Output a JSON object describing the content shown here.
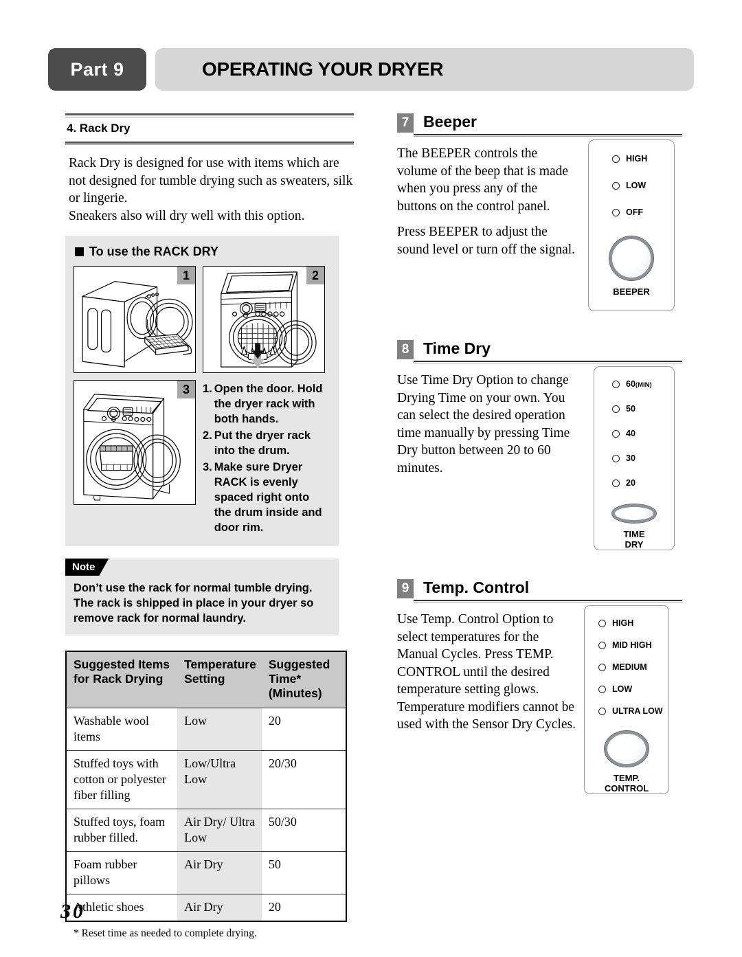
{
  "header": {
    "part_label": "Part 9",
    "title": "OPERATING YOUR DRYER"
  },
  "left_column": {
    "section_heading": "4. Rack Dry",
    "intro_paragraph_1": "Rack Dry is designed for use with items which are not designed for tumble drying such as sweaters, silk or lingerie.",
    "intro_paragraph_2": "Sneakers also will dry well with this option.",
    "rack_panel": {
      "title": "To use the RACK DRY",
      "figures": [
        {
          "number": "1",
          "caption": "dryer-with-rack-pulled-out-illustration"
        },
        {
          "number": "2",
          "caption": "inserting-rack-into-drum-illustration"
        },
        {
          "number": "3",
          "caption": "rack-installed-in-drum-illustration"
        }
      ],
      "steps": [
        {
          "num": "1.",
          "text": "Open the door. Hold the dryer rack with both hands."
        },
        {
          "num": "2.",
          "text": "Put the dryer rack into the drum."
        },
        {
          "num": "3.",
          "text": "Make sure Dryer RACK is evenly spaced right onto the drum inside and door rim."
        }
      ]
    },
    "note": {
      "tag": "Note",
      "line1": "Don’t use the rack for normal tumble drying.",
      "line2": "The rack is shipped in place in your dryer so remove rack for normal laundry."
    },
    "table": {
      "headers": [
        "Suggested Items for Rack Drying",
        "Temperature Setting",
        "Suggested Time* (Minutes)"
      ],
      "header_lines": [
        [
          "Suggested Items",
          "for Rack Drying"
        ],
        [
          "Temperature",
          "Setting"
        ],
        [
          "Suggested",
          "Time*",
          "(Minutes)"
        ]
      ],
      "rows": [
        {
          "item": "Washable wool items",
          "temperature": "Low",
          "time": "20"
        },
        {
          "item": "Stuffed toys with cotton or polyester fiber filling",
          "temperature": "Low/Ultra Low",
          "time": "20/30"
        },
        {
          "item": "Stuffed toys, foam rubber filled.",
          "temperature": "Air Dry/ Ultra Low",
          "time": "50/30"
        },
        {
          "item": "Foam rubber pillows",
          "temperature": "Air Dry",
          "time": "50"
        },
        {
          "item": "Athletic shoes",
          "temperature": "Air Dry",
          "time": "20"
        }
      ],
      "footnote": "* Reset time as needed to complete drying."
    }
  },
  "right_column": {
    "sections": [
      {
        "badge": "7",
        "title": "Beeper",
        "paragraphs": [
          "The BEEPER controls the volume of the beep that is made when you press any of the buttons on the control panel.",
          "Press BEEPER to adjust the sound level or turn off the signal."
        ],
        "panel": {
          "options": [
            "HIGH",
            "LOW",
            "OFF"
          ],
          "button_label": "BEEPER"
        }
      },
      {
        "badge": "8",
        "title": "Time Dry",
        "paragraphs": [
          "Use Time Dry Option to change Drying Time on your own. You can select the desired operation time manually by pressing Time Dry button between 20 to 60 minutes."
        ],
        "panel": {
          "options": [
            "60(MIN)",
            "50",
            "40",
            "30",
            "20"
          ],
          "button_label": "TIME DRY",
          "button_label_lines": [
            "TIME",
            "DRY"
          ]
        }
      },
      {
        "badge": "9",
        "title": "Temp. Control",
        "paragraphs": [
          "Use Temp. Control Option to select temperatures for the Manual Cycles. Press TEMP. CONTROL until the desired temperature setting glows. Temperature modifiers cannot be used with the Sensor Dry Cycles."
        ],
        "panel": {
          "options": [
            "HIGH",
            "MID HIGH",
            "MEDIUM",
            "LOW",
            "ULTRA LOW"
          ],
          "button_label": "TEMP. CONTROL",
          "button_label_lines": [
            "TEMP.",
            "CONTROL"
          ]
        }
      }
    ]
  },
  "page_number": "30",
  "colors": {
    "part_badge_bg": "#4c4c4c",
    "title_bar_bg": "#d6d6d6",
    "section_badge_bg": "#808080",
    "panel_bg": "#e6e6e6",
    "table_header_bg": "#c9c9c9",
    "table_shade_bg": "#e6e6e6",
    "note_tag_bg": "#000000"
  }
}
